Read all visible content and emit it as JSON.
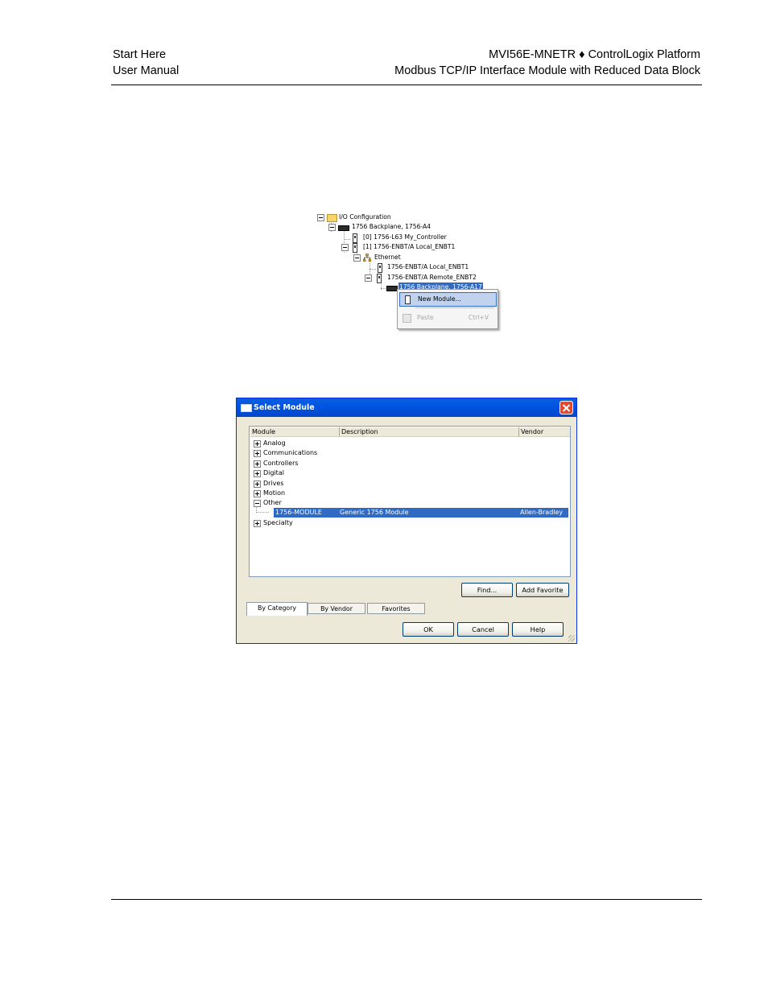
{
  "header": {
    "left_line1": "Start Here",
    "left_line2": "User Manual",
    "right_line1": "MVI56E-MNETR ♦ ControlLogix Platform",
    "right_line2": "Modbus TCP/IP Interface Module with Reduced Data Block"
  },
  "tree": {
    "nodes": [
      {
        "label": "I/O Configuration",
        "icon": "folder-icon"
      },
      {
        "label": "1756 Backplane, 1756-A4",
        "icon": "backplane-icon"
      },
      {
        "label": "[0] 1756-L63 My_Controller",
        "icon": "controller-icon"
      },
      {
        "label": "[1] 1756-ENBT/A Local_ENBT1",
        "icon": "module-icon"
      },
      {
        "label": "Ethernet",
        "icon": "network-icon"
      },
      {
        "label": "1756-ENBT/A Local_ENBT1",
        "icon": "module-icon"
      },
      {
        "label": "1756-ENBT/A Remote_ENBT2",
        "icon": "module-icon"
      },
      {
        "label": "1756 Backplane, 1756-A17",
        "icon": "backplane-icon"
      }
    ],
    "context_menu": {
      "new_module": "New Module...",
      "paste": "Paste",
      "paste_shortcut": "Ctrl+V"
    }
  },
  "dialog": {
    "title": "Select Module",
    "columns": {
      "module": "Module",
      "description": "Description",
      "vendor": "Vendor"
    },
    "categories": [
      "Analog",
      "Communications",
      "Controllers",
      "Digital",
      "Drives",
      "Motion",
      "Other",
      "Specialty"
    ],
    "selected_row": {
      "module": "1756-MODULE",
      "description": "Generic 1756 Module",
      "vendor": "Allen-Bradley"
    },
    "buttons": {
      "find": "Find...",
      "add_favorite": "Add Favorite",
      "ok": "OK",
      "cancel": "Cancel",
      "help": "Help"
    },
    "tabs": [
      "By Category",
      "By Vendor",
      "Favorites"
    ]
  }
}
